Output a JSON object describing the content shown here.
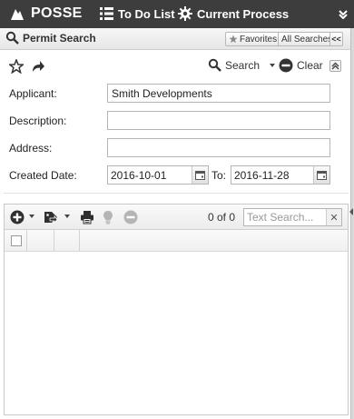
{
  "app": {
    "brand": "POSSE",
    "nav": [
      {
        "label": "To Do List",
        "icon": "list-icon"
      },
      {
        "label": "Current Process",
        "icon": "gear-icon"
      }
    ]
  },
  "panel": {
    "title": "Permit Search",
    "favorites_label": "Favorites",
    "all_searches_label": "All Searches",
    "collapse_label": "<<"
  },
  "search_toolbar": {
    "search_label": "Search",
    "clear_label": "Clear"
  },
  "form": {
    "applicant_label": "Applicant:",
    "applicant_value": "Smith Developments",
    "description_label": "Description:",
    "description_value": "",
    "address_label": "Address:",
    "address_value": "",
    "created_date_label": "Created Date:",
    "created_from": "2016-10-01",
    "to_label": "To:",
    "created_to": "2016-11-28"
  },
  "grid": {
    "page_count": "0 of 0",
    "text_search_placeholder": "Text Search...",
    "clear_symbol": "✕",
    "rows": []
  },
  "colors": {
    "topbar": "#3d3d3d",
    "icon_dark": "#2f2f2f",
    "icon_disabled": "#b5b5b5"
  }
}
